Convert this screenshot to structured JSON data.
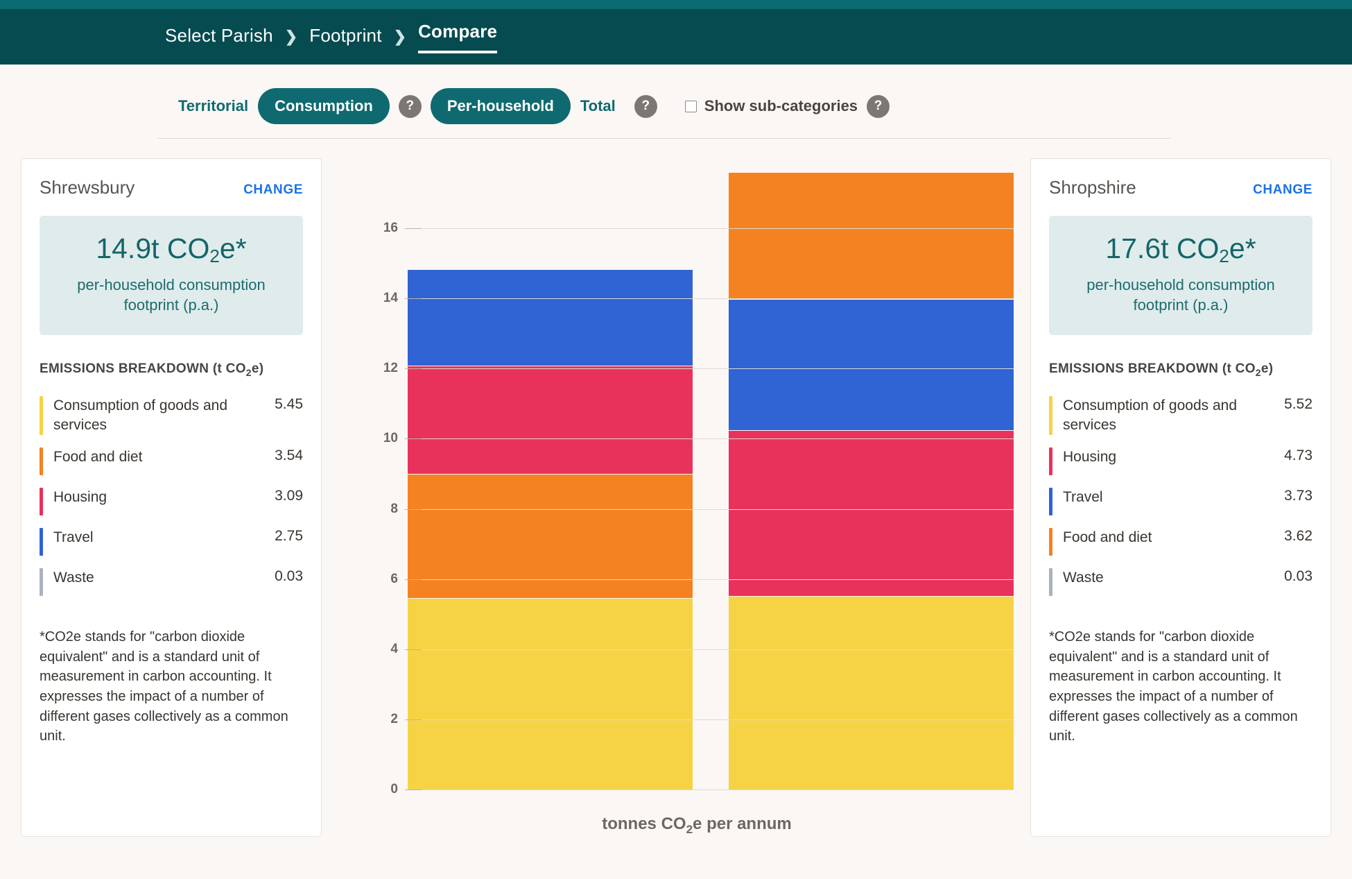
{
  "breadcrumb": {
    "items": [
      {
        "label": "Select Parish",
        "active": false
      },
      {
        "label": "Footprint",
        "active": false
      },
      {
        "label": "Compare",
        "active": true
      }
    ],
    "separator": "❯"
  },
  "toolbar": {
    "territorial_label": "Territorial",
    "consumption_label": "Consumption",
    "help1_label": "?",
    "per_household_label": "Per-household",
    "total_label": "Total",
    "help2_label": "?",
    "show_subcategories_label": "Show sub-categories",
    "show_subcategories_checked": false,
    "help3_label": "?"
  },
  "left_panel": {
    "place": "Shrewsbury",
    "change_label": "CHANGE",
    "hero_value": "14.9t CO",
    "hero_sub_digit": "2",
    "hero_value_suffix": "e*",
    "hero_caption": "per-household consumption footprint (p.a.)",
    "breakdown_title_prefix": "EMISSIONS BREAKDOWN (t CO",
    "breakdown_title_sub": "2",
    "breakdown_title_suffix": "e)",
    "items": [
      {
        "label": "Consumption of goods and services",
        "value": "5.45",
        "color": "#f6d344"
      },
      {
        "label": "Food and diet",
        "value": "3.54",
        "color": "#f58220"
      },
      {
        "label": "Housing",
        "value": "3.09",
        "color": "#e9325b"
      },
      {
        "label": "Travel",
        "value": "2.75",
        "color": "#3063d3"
      },
      {
        "label": "Waste",
        "value": "0.03",
        "color": "#a9b3c0"
      }
    ],
    "note": "*CO2e stands for \"carbon dioxide equivalent\" and is a standard unit of measurement in carbon accounting. It expresses the impact of a number of different gases collectively as a common unit."
  },
  "right_panel": {
    "place": "Shropshire",
    "change_label": "CHANGE",
    "hero_value": "17.6t CO",
    "hero_sub_digit": "2",
    "hero_value_suffix": "e*",
    "hero_caption": "per-household consumption footprint (p.a.)",
    "breakdown_title_prefix": "EMISSIONS BREAKDOWN (t CO",
    "breakdown_title_sub": "2",
    "breakdown_title_suffix": "e)",
    "items": [
      {
        "label": "Consumption of goods and services",
        "value": "5.52",
        "color": "#f6d344"
      },
      {
        "label": "Housing",
        "value": "4.73",
        "color": "#e9325b"
      },
      {
        "label": "Travel",
        "value": "3.73",
        "color": "#3063d3"
      },
      {
        "label": "Food and diet",
        "value": "3.62",
        "color": "#f58220"
      },
      {
        "label": "Waste",
        "value": "0.03",
        "color": "#a9b3c0"
      }
    ],
    "note": "*CO2e stands for \"carbon dioxide equivalent\" and is a standard unit of measurement in carbon accounting. It expresses the impact of a number of different gases collectively as a common unit."
  },
  "chart_data": {
    "type": "bar",
    "stacked": true,
    "title": "",
    "xlabel_prefix": "tonnes CO",
    "xlabel_sub": "2",
    "xlabel_suffix": "e per annum",
    "categories": [
      "Shrewsbury",
      "Shropshire"
    ],
    "ylim": [
      0,
      17.8
    ],
    "yticks": [
      0,
      2,
      4,
      6,
      8,
      10,
      12,
      14,
      16
    ],
    "grid": true,
    "legend": "none",
    "series": [
      {
        "name": "Consumption of goods and services",
        "color": "#f6d344",
        "values": [
          5.45,
          5.52
        ]
      },
      {
        "name": "Food and diet",
        "color": "#f58220",
        "values": [
          3.54,
          3.62
        ]
      },
      {
        "name": "Housing",
        "color": "#e9325b",
        "values": [
          3.09,
          4.73
        ]
      },
      {
        "name": "Travel",
        "color": "#3063d3",
        "values": [
          2.75,
          3.73
        ]
      },
      {
        "name": "Waste",
        "color": "#a9b3c0",
        "values": [
          0.03,
          0.03
        ]
      }
    ],
    "stack_order": [
      [
        "Consumption of goods and services",
        "Food and diet",
        "Housing",
        "Travel"
      ],
      [
        "Consumption of goods and services",
        "Housing",
        "Travel",
        "Food and diet"
      ]
    ],
    "totals": [
      14.9,
      17.6
    ]
  },
  "theme": {
    "teal_dark": "#054b50",
    "teal": "#0e6a70",
    "page_bg": "#fbf7f5",
    "link_blue": "#1a73e8"
  }
}
